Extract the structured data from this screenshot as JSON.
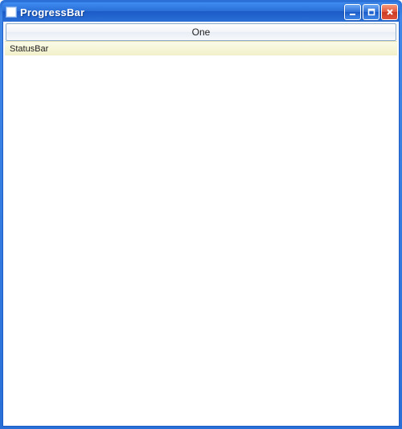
{
  "window": {
    "title": "ProgressBar"
  },
  "header": {
    "tab_label": "One"
  },
  "statusbar": {
    "text": "StatusBar"
  }
}
